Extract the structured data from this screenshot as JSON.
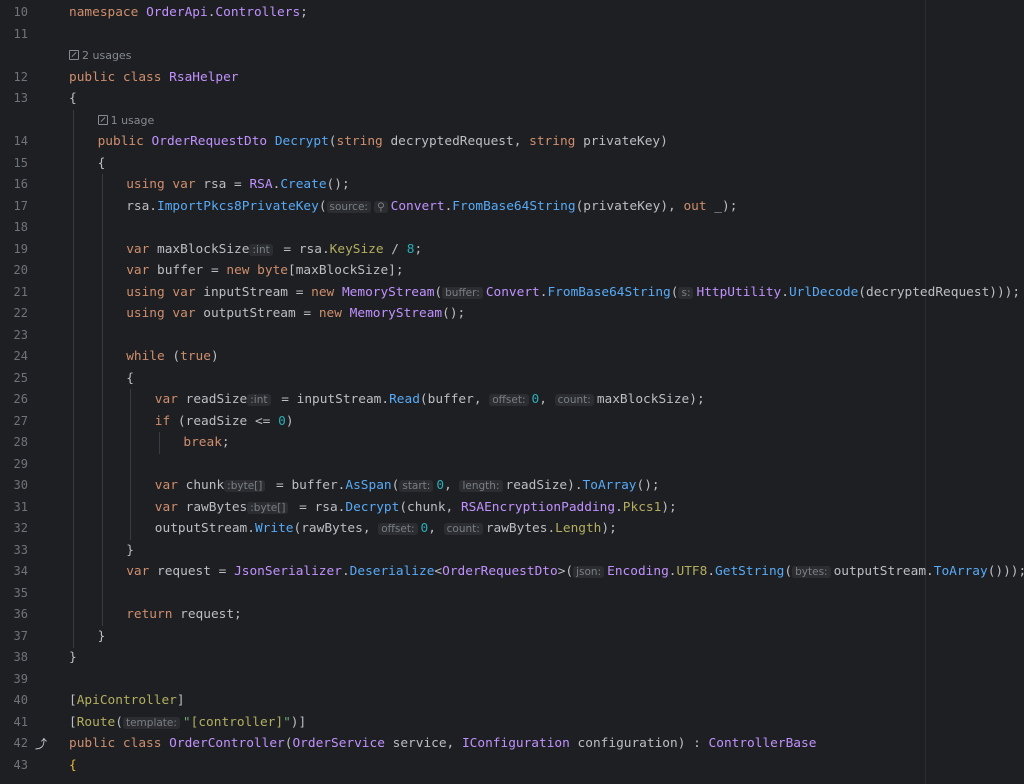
{
  "lines": [
    {
      "n": "10",
      "code": "<span class='kw'>namespace</span> <span class='cls'>OrderApi</span>.<span class='cls'>Controllers</span>;",
      "indent": 0
    },
    {
      "n": "11",
      "code": "",
      "indent": 0
    },
    {
      "usage": "2 usages",
      "indent": 0
    },
    {
      "n": "12",
      "code": "<span class='kw'>public class</span> <span class='cls'>RsaHelper</span>",
      "indent": 0
    },
    {
      "n": "13",
      "code": "{",
      "indent": 0
    },
    {
      "usage": "1 usage",
      "indent": 1
    },
    {
      "n": "14",
      "code": "<span class='kw'>public</span> <span class='cls'>OrderRequestDto</span> <span class='fn'>Decrypt</span>(<span class='kw'>string</span> decryptedRequest, <span class='kw'>string</span> privateKey)",
      "indent": 1
    },
    {
      "n": "15",
      "code": "{",
      "indent": 1
    },
    {
      "n": "16",
      "code": "<span class='kw'>using var</span> rsa = <span class='cls'>RSA</span>.<span class='mth'>Create</span>();",
      "indent": 2
    },
    {
      "n": "17",
      "code": "rsa.<span class='mth'>ImportPkcs8PrivateKey</span>(<span class='hint'>source:</span><span class='hint'>&#9906;</span><span class='cls'>Convert</span>.<span class='mth'>FromBase64String</span>(privateKey), <span class='kw'>out</span> _);",
      "indent": 2
    },
    {
      "n": "18",
      "code": "",
      "indent": 2
    },
    {
      "n": "19",
      "code": "<span class='kw'>var</span> maxBlockSize<span class='hint'>:int</span> = rsa.<span class='attr'>KeySize</span> / <span class='num'>8</span>;",
      "indent": 2
    },
    {
      "n": "20",
      "code": "<span class='kw'>var</span> buffer = <span class='kw'>new byte</span>[maxBlockSize];",
      "indent": 2
    },
    {
      "n": "21",
      "code": "<span class='kw'>using var</span> inputStream = <span class='kw'>new</span> <span class='cls'>MemoryStream</span>(<span class='hint'>buffer:</span><span class='cls'>Convert</span>.<span class='mth'>FromBase64String</span>(<span class='hint'>s:</span><span class='cls'>HttpUtility</span>.<span class='mth'>UrlDecode</span>(decryptedRequest)));",
      "indent": 2
    },
    {
      "n": "22",
      "code": "<span class='kw'>using var</span> outputStream = <span class='kw'>new</span> <span class='cls'>MemoryStream</span>();",
      "indent": 2
    },
    {
      "n": "23",
      "code": "",
      "indent": 2
    },
    {
      "n": "24",
      "code": "<span class='kw'>while</span> (<span class='kw'>true</span>)",
      "indent": 2
    },
    {
      "n": "25",
      "code": "{",
      "indent": 2
    },
    {
      "n": "26",
      "code": "<span class='kw'>var</span> readSize<span class='hint'>:int</span> = inputStream.<span class='mth'>Read</span>(buffer, <span class='hint'>offset:</span><span class='num'>0</span>, <span class='hint'>count:</span>maxBlockSize);",
      "indent": 3
    },
    {
      "n": "27",
      "code": "<span class='kw'>if</span> (readSize &lt;= <span class='num'>0</span>)",
      "indent": 3
    },
    {
      "n": "28",
      "code": "<span class='kw'>break</span>;",
      "indent": 4
    },
    {
      "n": "29",
      "code": "",
      "indent": 3
    },
    {
      "n": "30",
      "code": "<span class='kw'>var</span> chunk<span class='hint'>:byte[]</span> = buffer.<span class='mth'>AsSpan</span>(<span class='hint'>start:</span><span class='num'>0</span>, <span class='hint'>length:</span>readSize).<span class='mth'>ToArray</span>();",
      "indent": 3
    },
    {
      "n": "31",
      "code": "<span class='kw'>var</span> rawBytes<span class='hint'>:byte[]</span> = rsa.<span class='mth'>Decrypt</span>(chunk, <span class='cls'>RSAEncryptionPadding</span>.<span class='attr'>Pkcs1</span>);",
      "indent": 3
    },
    {
      "n": "32",
      "code": "outputStream.<span class='mth'>Write</span>(rawBytes, <span class='hint'>offset:</span><span class='num'>0</span>, <span class='hint'>count:</span>rawBytes.<span class='attr'>Length</span>);",
      "indent": 3
    },
    {
      "n": "33",
      "code": "}",
      "indent": 2
    },
    {
      "n": "34",
      "code": "<span class='kw'>var</span> request = <span class='cls'>JsonSerializer</span>.<span class='mth'>Deserialize</span>&lt;<span class='cls'>OrderRequestDto</span>&gt;(<span class='hint'>json:</span><span class='cls'>Encoding</span>.<span class='attr'>UTF8</span>.<span class='mth'>GetString</span>(<span class='hint'>bytes:</span>outputStream.<span class='mth'>ToArray</span>()));",
      "indent": 2
    },
    {
      "n": "35",
      "code": "",
      "indent": 2
    },
    {
      "n": "36",
      "code": "<span class='kw'>return</span> request;",
      "indent": 2
    },
    {
      "n": "37",
      "code": "}",
      "indent": 1
    },
    {
      "n": "38",
      "code": "}",
      "indent": 0
    },
    {
      "n": "39",
      "code": "",
      "indent": 0
    },
    {
      "n": "40",
      "code": "[<span class='attr'>ApiController</span>]",
      "indent": 0
    },
    {
      "n": "41",
      "code": "[<span class='attr'>Route</span>(<span class='hint'>template:</span><span class='str'>\"</span><span class='attr'>[controller]</span><span class='str'>\"</span>)]",
      "indent": 0
    },
    {
      "n": "42",
      "code": "<span class='kw'>public class</span> <span class='cls'>OrderController</span>(<span class='cls'>OrderService</span> service, <span class='cls'>IConfiguration</span> configuration) : <span class='cls'>ControllerBase</span>",
      "indent": 0,
      "fold": true
    },
    {
      "n": "43",
      "code": "<span class='brace-hl'>{</span>",
      "indent": 0
    }
  ]
}
